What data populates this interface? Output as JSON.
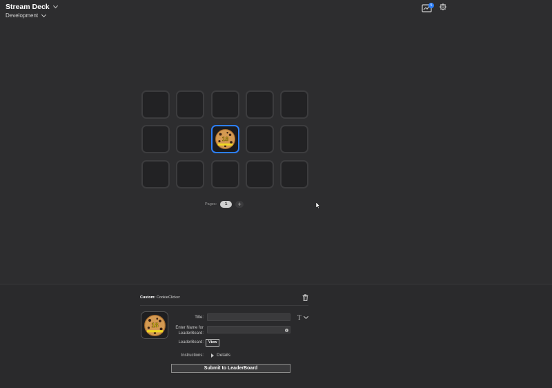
{
  "header": {
    "app_title": "Stream Deck",
    "profile": "Development",
    "store_badge_count": "5"
  },
  "grid": {
    "rows": 3,
    "columns": 5,
    "assigned_key": {
      "row": 2,
      "column": 3,
      "action": "CookieClicker",
      "icon_text": "18"
    }
  },
  "pages": {
    "label": "Pages:",
    "current": "1",
    "add_label": "+"
  },
  "inspector": {
    "category": "Custom:",
    "action_name": "CookieClicker",
    "title_label": "Title:",
    "title_value": "",
    "name_label": "Enter Name for LeaderBoard:",
    "name_value": "",
    "leaderboard_label": "LeaderBoard:",
    "view_button": "View",
    "instructions_label": "Instructions:",
    "details_label": "Details",
    "submit_button": "Submit to LeaderBoard",
    "text_format_icon": "T"
  },
  "colors": {
    "background": "#2d2d2f",
    "accent": "#2d7ff9",
    "key_background": "#222224"
  },
  "icons": [
    "chevron-down-icon",
    "store-icon",
    "gear-icon",
    "trash-icon",
    "info-icon",
    "cookie-icon"
  ]
}
